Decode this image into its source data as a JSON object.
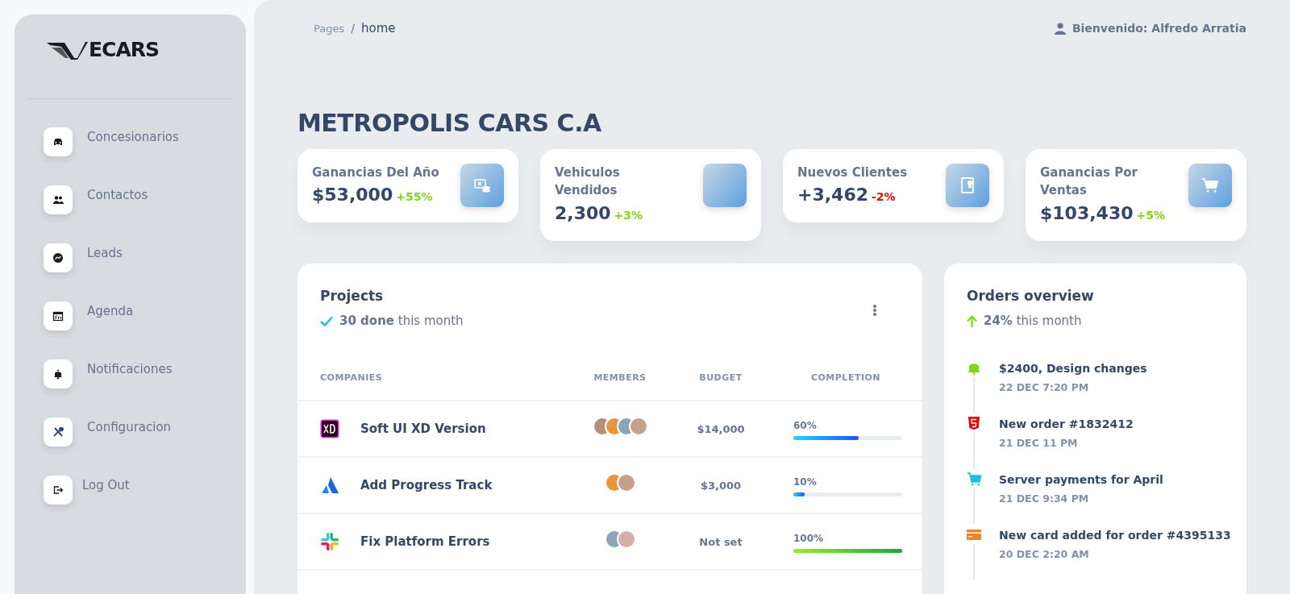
{
  "sidebar": {
    "logo": "ECARS",
    "items": [
      {
        "label": "Concesionarios"
      },
      {
        "label": "Contactos"
      },
      {
        "label": "Leads"
      },
      {
        "label": "Agenda"
      },
      {
        "label": "Notificaciones"
      },
      {
        "label": "Configuracion"
      },
      {
        "label": "Log Out"
      }
    ]
  },
  "breadcrumb": {
    "parent": "Pages",
    "separator": "/",
    "current": "home"
  },
  "user": {
    "greeting": "Bienvenido: Alfredo Arratia"
  },
  "page_title": "METROPOLIS CARS C.A",
  "stats": [
    {
      "title": "Ganancias Del Año",
      "value": "$53,000",
      "change": "+55%",
      "kind": "gain"
    },
    {
      "title": "Vehiculos Vendidos",
      "value": "2,300",
      "change": "+3%",
      "kind": "gain"
    },
    {
      "title": "Nuevos Clientes",
      "value": "+3,462",
      "change": "-2%",
      "kind": "loss"
    },
    {
      "title": "Ganancias Por Ventas",
      "value": "$103,430",
      "change": "+5%",
      "kind": "gain"
    }
  ],
  "projects": {
    "title": "Projects",
    "summary": "**30 done** this month",
    "columns": [
      "COMPANIES",
      "MEMBERS",
      "BUDGET",
      "COMPLETION"
    ],
    "rows": [
      {
        "name": "Soft UI XD Version",
        "members": [
          {
            "color": "#b58e7d"
          },
          {
            "color": "#e8953c"
          },
          {
            "color": "#8aa4b8"
          },
          {
            "color": "#c6a08c"
          }
        ],
        "budget": "$14,000",
        "completion": "60%",
        "level": 0.6
      },
      {
        "name": "Add Progress Track",
        "members": [
          {
            "color": "#e8953c"
          },
          {
            "color": "#c6a08c"
          }
        ],
        "budget": "$3,000",
        "completion": "10%",
        "level": 0.1
      },
      {
        "name": "Fix Platform Errors",
        "members": [
          {
            "color": "#8aa4b8"
          },
          {
            "color": "#d2b0a8"
          }
        ],
        "budget": "Not set",
        "completion": "100%",
        "level": 1.0
      }
    ]
  },
  "orders": {
    "title": "Orders overview",
    "summary": "**24%** this month",
    "events": [
      {
        "title": "$2400, Design changes",
        "time": "22 DEC 7:20 PM",
        "color": "#82d616"
      },
      {
        "title": "New order #1832412",
        "time": "21 DEC 11 PM",
        "color": "#ea0606"
      },
      {
        "title": "Server payments for April",
        "time": "21 DEC 9:34 PM",
        "color": "#17c1e8"
      },
      {
        "title": "New card added for order #4395133",
        "time": "20 DEC 2:20 AM",
        "color": "#f58220"
      }
    ]
  }
}
